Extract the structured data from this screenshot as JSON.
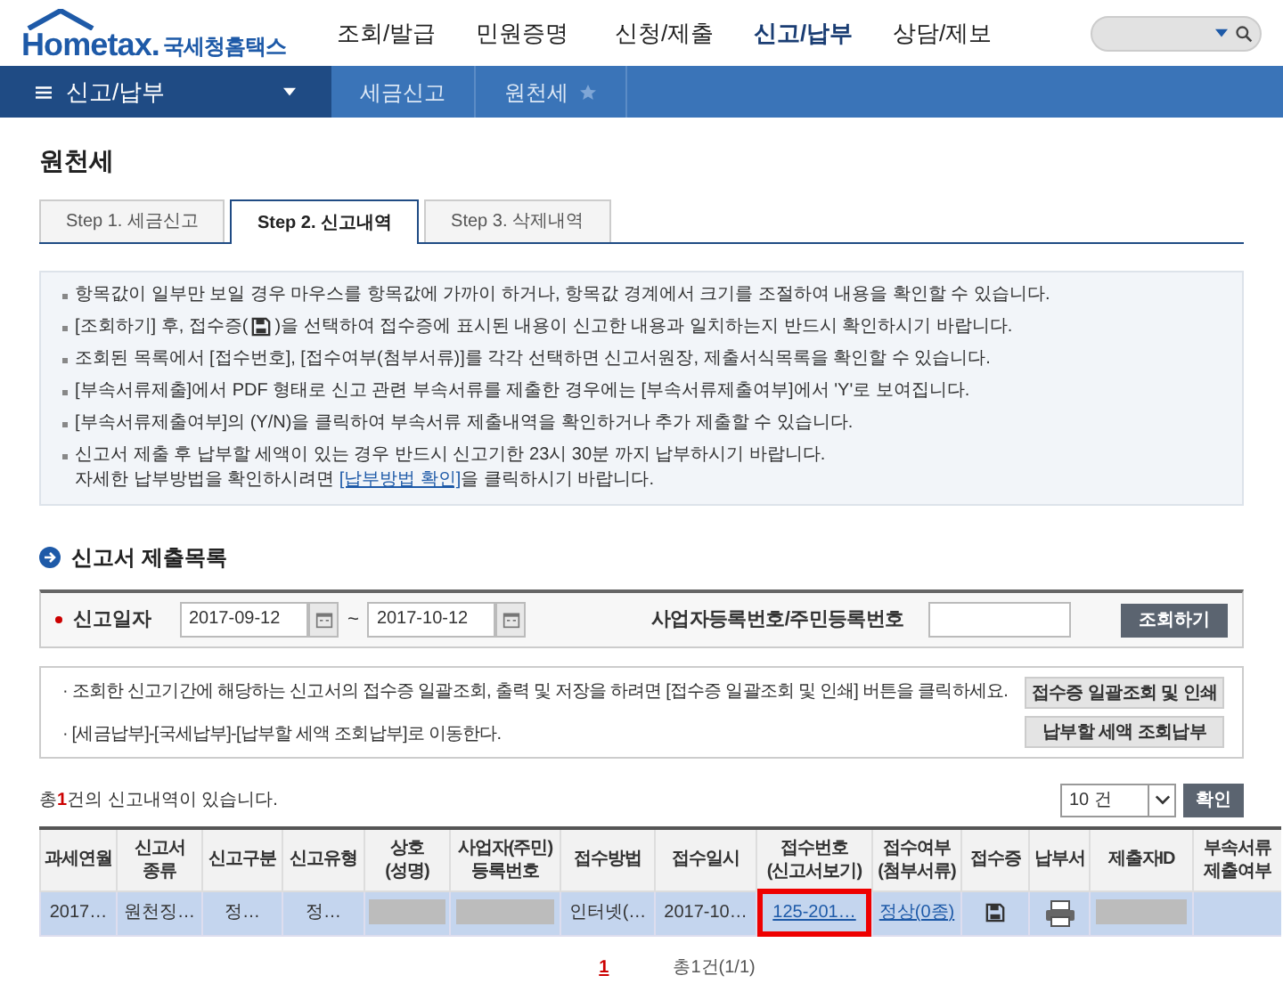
{
  "logo": {
    "brand": "Hometax.",
    "subtitle": "국세청홈택스"
  },
  "nav": [
    {
      "label": "조회/발급",
      "selected": false
    },
    {
      "label": "민원증명",
      "selected": false
    },
    {
      "label": "신청/제출",
      "selected": false
    },
    {
      "label": "신고/납부",
      "selected": true
    },
    {
      "label": "상담/제보",
      "selected": false
    }
  ],
  "breadcrumb": {
    "menu": "신고/납부",
    "items": [
      "세금신고",
      "원천세"
    ]
  },
  "page_title": "원천세",
  "tabs": [
    {
      "label": "Step 1. 세금신고",
      "selected": false
    },
    {
      "label": "Step 2. 신고내역",
      "selected": true
    },
    {
      "label": "Step 3. 삭제내역",
      "selected": false
    }
  ],
  "info": [
    {
      "segments": [
        {
          "kind": "text",
          "text": "항목값이 일부만 보일 경우 마우스를 항목값에 가까이 하거나, 항목값 경계에서 크기를 조절하여 내용을 확인할 수 있습니다."
        }
      ]
    },
    {
      "segments": [
        {
          "kind": "text",
          "text": "[조회하기] 후, 접수증("
        },
        {
          "kind": "disk"
        },
        {
          "kind": "text",
          "text": ")을 선택하여 접수증에 표시된 내용이 신고한 내용과 일치하는지 반드시 확인하시기 바랍니다."
        }
      ]
    },
    {
      "segments": [
        {
          "kind": "text",
          "text": "조회된 목록에서 [접수번호], [접수여부(첨부서류)]를 각각 선택하면 신고서원장, 제출서식목록을 확인할 수 있습니다."
        }
      ]
    },
    {
      "segments": [
        {
          "kind": "text",
          "text": "[부속서류제출]에서 PDF 형태로 신고 관련 부속서류를 제출한 경우에는 [부속서류제출여부]에서 'Y'로 보여집니다."
        }
      ]
    },
    {
      "segments": [
        {
          "kind": "text",
          "text": "[부속서류제출여부]의 (Y/N)을 클릭하여 부속서류 제출내역을 확인하거나 추가 제출할 수 있습니다."
        }
      ]
    },
    {
      "segments": [
        {
          "kind": "text",
          "text": "신고서 제출 후 납부할 세액이 있는 경우 반드시 신고기한 23시 30분 까지 납부하시기 바랍니다."
        },
        {
          "kind": "break"
        },
        {
          "kind": "text",
          "text": "자세한 납부방법을 확인하시려면 "
        },
        {
          "kind": "link",
          "text": "[납부방법 확인]"
        },
        {
          "kind": "text",
          "text": "을 클릭하시기 바랍니다."
        }
      ]
    }
  ],
  "section_title": "신고서 제출목록",
  "search": {
    "date_label": "신고일자",
    "from": "2017-09-12",
    "separator": "~",
    "to": "2017-10-12",
    "id_label": "사업자등록번호/주민등록번호",
    "button": "조회하기"
  },
  "notices": [
    "· 조회한 신고기간에 해당하는 신고서의 접수증 일괄조회, 출력 및 저장을 하려면 [접수증 일괄조회 및 인쇄] 버튼을 클릭하세요.",
    "· [세금납부]-[국세납부]-[납부할 세액 조회납부]로 이동한다."
  ],
  "notice_buttons": [
    "접수증 일괄조회 및 인쇄",
    "납부할 세액 조회납부"
  ],
  "count_text": "총**1**건의 신고내역이 있습니다.",
  "page_size": "10 건",
  "confirm_button": "확인",
  "table": {
    "columns": [
      "과세연월",
      "신고서\n종류",
      "신고구분",
      "신고유형",
      "상호\n(성명)",
      "사업자(주민)\n등록번호",
      "접수방법",
      "접수일시",
      "접수번호\n(신고서보기)",
      "접수여부\n(첨부서류)",
      "접수증",
      "납부서",
      "제출자ID",
      "부속서류\n제출여부"
    ],
    "rows": [
      {
        "selected": true,
        "cells": [
          {
            "kind": "text",
            "text": "2017…"
          },
          {
            "kind": "text",
            "text": "원천징…"
          },
          {
            "kind": "text",
            "text": "정…"
          },
          {
            "kind": "text",
            "text": "정…"
          },
          {
            "kind": "redacted"
          },
          {
            "kind": "redacted"
          },
          {
            "kind": "text",
            "text": "인터넷(…"
          },
          {
            "kind": "text",
            "text": "2017-10…"
          },
          {
            "kind": "link",
            "text": "125-201…",
            "highlighted": true
          },
          {
            "kind": "link",
            "text": "정상(0종)",
            "highlighted": false
          },
          {
            "kind": "disk"
          },
          {
            "kind": "printer"
          },
          {
            "kind": "redacted"
          },
          {
            "kind": "empty"
          }
        ]
      }
    ]
  },
  "pagination": {
    "current": "1",
    "summary": "총1건(1/1)"
  }
}
